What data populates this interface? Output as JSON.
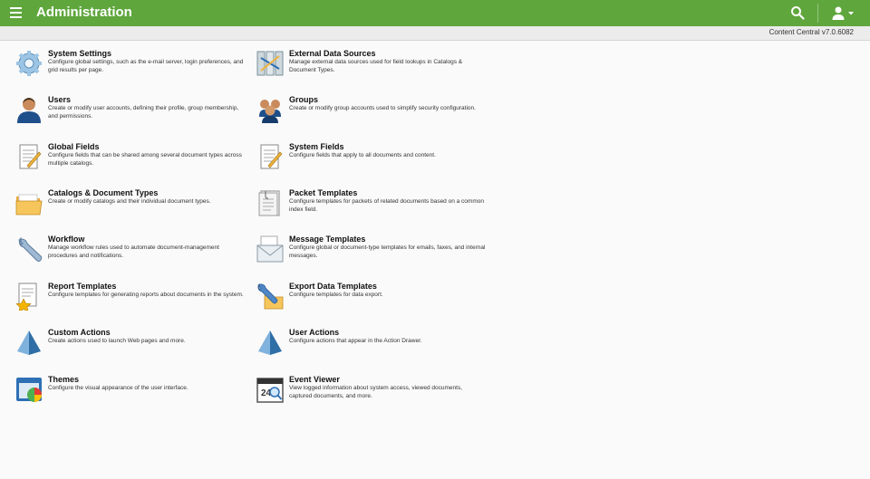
{
  "header": {
    "title": "Administration"
  },
  "subheader": {
    "version": "Content Central v7.0.6082"
  },
  "left_items": [
    {
      "name": "System Settings",
      "desc": "Configure global settings, such as the e-mail server, login preferences, and grid results per page."
    },
    {
      "name": "Users",
      "desc": "Create or modify user accounts, defining their profile, group membership, and permissions."
    },
    {
      "name": "Global Fields",
      "desc": "Configure fields that can be shared among several document types across multiple catalogs."
    },
    {
      "name": "Catalogs & Document Types",
      "desc": "Create or modify catalogs and their individual document types."
    },
    {
      "name": "Workflow",
      "desc": "Manage workflow rules used to automate document-management procedures and notifications."
    },
    {
      "name": "Report Templates",
      "desc": "Configure templates for generating reports about documents in the system."
    },
    {
      "name": "Custom Actions",
      "desc": "Create actions used to launch Web pages and more."
    },
    {
      "name": "Themes",
      "desc": "Configure the visual appearance of the user interface."
    }
  ],
  "right_items": [
    {
      "name": "External Data Sources",
      "desc": "Manage external data sources used for field lookups in Catalogs & Document Types."
    },
    {
      "name": "Groups",
      "desc": "Create or modify group accounts used to simplify security configuration."
    },
    {
      "name": "System Fields",
      "desc": "Configure fields that apply to all documents and content."
    },
    {
      "name": "Packet Templates",
      "desc": "Configure templates for packets of related documents based on a common index field."
    },
    {
      "name": "Message Templates",
      "desc": "Configure global or document-type templates for emails, faxes, and internal messages."
    },
    {
      "name": "Export Data Templates",
      "desc": "Configure templates for data export."
    },
    {
      "name": "User Actions",
      "desc": "Configure actions that appear in the Action Drawer."
    },
    {
      "name": "Event Viewer",
      "desc": "View logged information about system access, viewed documents, captured documents, and more."
    }
  ],
  "icons": {
    "left": [
      "gear-icon",
      "user-icon",
      "document-edit-icon",
      "folder-icon",
      "wrench-icon",
      "report-star-icon",
      "pyramid-icon",
      "theme-palette-icon"
    ],
    "right": [
      "data-source-icon",
      "group-icon",
      "document-edit-icon",
      "packet-document-icon",
      "message-envelope-icon",
      "export-folder-wrench-icon",
      "pyramid-icon",
      "calendar-search-icon"
    ]
  },
  "colors": {
    "header": "#5fa63d",
    "accent": "#5fa63d"
  }
}
